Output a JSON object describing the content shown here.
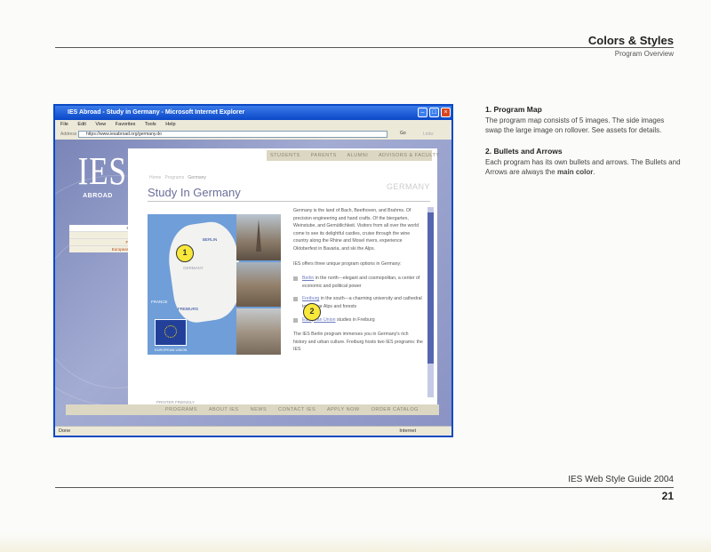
{
  "header": {
    "title": "Colors & Styles",
    "subtitle": "Program Overview"
  },
  "footer": {
    "guide": "IES Web Style Guide 2004",
    "page": "21"
  },
  "notes": [
    {
      "heading": "1. Program Map",
      "text": "The program map consists of 5 images. The side images swap the large image on rollover. See assets for details."
    },
    {
      "heading": "2. Bullets and Arrows",
      "text": "Each program has its own bullets and arrows. The Bullets and Arrows are always the",
      "emphasis": "main color",
      "end": "."
    }
  ],
  "browser": {
    "title": "IES Abroad - Study in Germany - Microsoft Internet Explorer",
    "menu": [
      "File",
      "Edit",
      "View",
      "Favorites",
      "Tools",
      "Help"
    ],
    "address_label": "Address",
    "address": "https://www.iesabroad.org/germany.do",
    "go": "Go",
    "links": "Links",
    "status": "Done",
    "zone": "Internet"
  },
  "site": {
    "logo": "IES",
    "logo_sub": "ABROAD",
    "top_nav": [
      "STUDENTS",
      "PARENTS",
      "ALUMNI",
      "ADVISORS & FACULTY"
    ],
    "side_nav": {
      "heading": "Germany",
      "items": [
        "Berlin »",
        "Freiburg »",
        "European Union »"
      ]
    },
    "breadcrumb": [
      "Home",
      "Programs",
      "Germany"
    ],
    "page_title": "Study In Germany",
    "country": "GERMANY",
    "map_labels": {
      "berlin": "BERLIN",
      "germany": "GERMANY",
      "france": "FRANCE",
      "freiburg": "FREIBURG",
      "eu": "EUROPEAN UNION"
    },
    "intro": "Germany is the land of Bach, Beethoven, and Brahms. Of precision engineering and hand crafts. Of the biergarten, Weinstube, and Gemütlichkeit. Visitors from all over the world come to see its delightful castles, cruise through the wine country along the Rhine and Mosel rivers, experience Oktoberfest in Bavaria, and ski the Alps.",
    "options_intro": "IES offers three unique program options in Germany:",
    "bullets": [
      {
        "link": "Berlin",
        "text": " in the north---elegant and cosmopolitan, a center of economic and political power"
      },
      {
        "link": "Freiburg",
        "text": " in the south---a charming university and cathedral town near Alps and forests"
      },
      {
        "link": "European Union",
        "text": " studies in Freiburg"
      }
    ],
    "closing": "The IES Berlin program immerses you in Germany's rich history and urban culture. Freiburg hosts two IES programs: the IES",
    "printer": "PRINTER FRIENDLY",
    "bottom_nav": [
      "PROGRAMS",
      "ABOUT IES",
      "NEWS",
      "CONTACT IES",
      "APPLY NOW",
      "ORDER CATALOG"
    ]
  },
  "callouts": [
    "1",
    "2"
  ]
}
